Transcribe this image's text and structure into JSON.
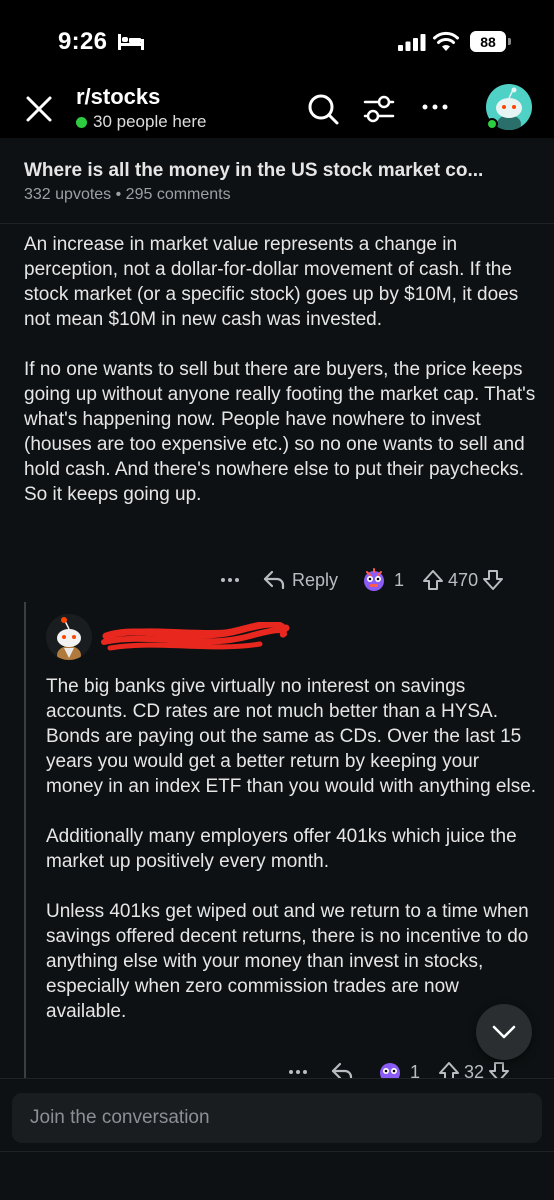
{
  "status_bar": {
    "time": "9:26",
    "battery": "88"
  },
  "header": {
    "subreddit": "r/stocks",
    "online_text": "30 people here"
  },
  "post": {
    "title": "Where is all the money in the US stock market co...",
    "meta": "332 upvotes • 295 comments"
  },
  "comment1": {
    "paragraphs": [
      "An increase in market value represents a change in perception, not a dollar-for-dollar movement of cash. If the stock market (or a specific stock) goes up by $10M, it does not mean $10M in new cash was invested.",
      "If no one wants to sell but there are buyers, the price keeps going up without anyone really footing the market cap. That's what's happening now. People have nowhere to invest (houses are too expensive etc.) so no one wants to sell and hold cash. And there's nowhere else to put their paychecks. So it keeps going up."
    ],
    "reply_label": "Reply",
    "award_count": "1",
    "score": "470"
  },
  "comment2": {
    "paragraphs": [
      "The big banks give virtually no interest on savings accounts. CD rates are not much better than a HYSA. Bonds are paying out the same as CDs. Over the last 15 years you would get a better return by keeping your money in an index ETF than you would with anything else.",
      "Additionally many employers offer 401ks which juice the market up positively every month.",
      "Unless 401ks get wiped out and we return to a time when savings offered decent returns, there is no incentive to do anything else with your money than invest in stocks, especially when zero commission trades are now available."
    ],
    "award_count": "1",
    "score": "32"
  },
  "composer": {
    "placeholder": "Join the conversation"
  },
  "colors": {
    "background": "#0e1113",
    "text": "#e6e6e6",
    "muted": "#9aa0a4",
    "online": "#2ecc40",
    "avatar": "#4fd1c5",
    "redaction": "#e8281e"
  }
}
